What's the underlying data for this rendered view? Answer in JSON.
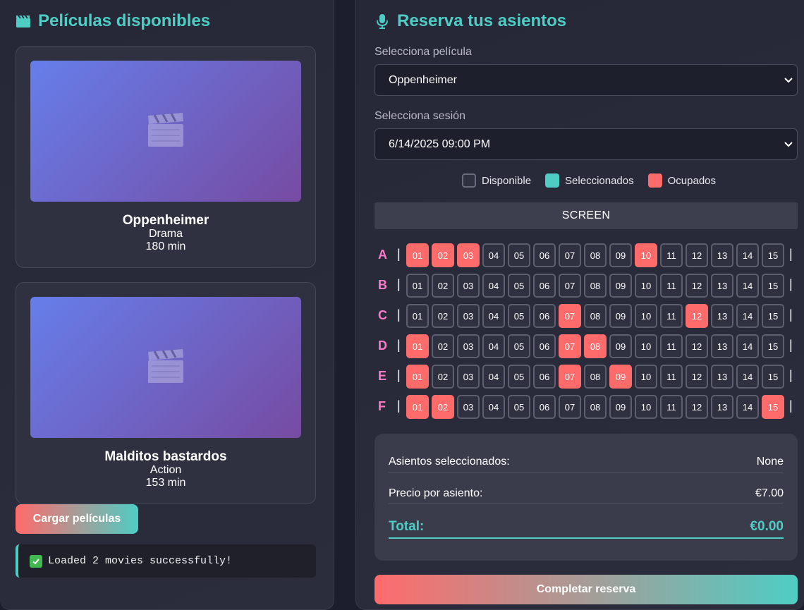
{
  "left_panel": {
    "title": "Películas disponibles",
    "title_icon": "clapperboard-icon",
    "movies": [
      {
        "title": "Oppenheimer",
        "genre": "Drama",
        "duration": "180 min",
        "poster_icon": "clapper-icon"
      },
      {
        "title": "Malditos bastardos",
        "genre": "Action",
        "duration": "153 min",
        "poster_icon": "clapper-icon"
      }
    ],
    "load_button": "Cargar películas",
    "status": {
      "icon": "check-mark-icon",
      "text": "Loaded 2 movies successfully!"
    }
  },
  "right_panel": {
    "title": "Reserva tus asientos",
    "title_icon": "microphone-icon",
    "movie_select": {
      "label": "Selecciona película",
      "value": "Oppenheimer"
    },
    "session_select": {
      "label": "Selecciona sesión",
      "value": "6/14/2025 09:00 PM"
    },
    "legend": {
      "available": "Disponible",
      "selected": "Seleccionados",
      "occupied": "Ocupados"
    },
    "screen_label": "SCREEN",
    "seats": {
      "rows": [
        "A",
        "B",
        "C",
        "D",
        "E",
        "F"
      ],
      "numbers": [
        "01",
        "02",
        "03",
        "04",
        "05",
        "06",
        "07",
        "08",
        "09",
        "10",
        "11",
        "12",
        "13",
        "14",
        "15"
      ],
      "occupied": {
        "A": [
          "01",
          "02",
          "03",
          "10"
        ],
        "B": [],
        "C": [
          "07",
          "12"
        ],
        "D": [
          "01",
          "07",
          "08"
        ],
        "E": [
          "01",
          "07",
          "09"
        ],
        "F": [
          "01",
          "02",
          "15"
        ]
      }
    },
    "summary": {
      "selected_label": "Asientos seleccionados:",
      "selected_value": "None",
      "price_label": "Precio por asiento:",
      "price_value": "€7.00",
      "total_label": "Total:",
      "total_value": "€0.00"
    },
    "complete_button": "Completar reserva"
  },
  "colors": {
    "accent": "#4ecdc4",
    "occupied": "#ff6b6b",
    "row_label": "#ff79c6",
    "poster_start": "#667eea",
    "poster_end": "#764ba2"
  }
}
